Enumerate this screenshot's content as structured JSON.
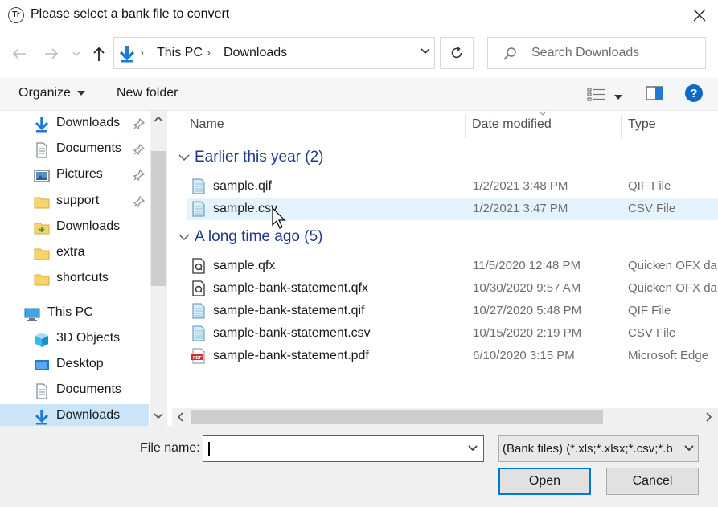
{
  "window": {
    "title": "Please select a bank file to convert",
    "app_icon_text": "Tr"
  },
  "nav": {
    "address_parts": [
      "This PC",
      "Downloads"
    ],
    "search_placeholder": "Search Downloads"
  },
  "toolbar": {
    "organize_label": "Organize",
    "new_folder_label": "New folder"
  },
  "sidebar": {
    "items": [
      {
        "label": "Downloads",
        "icon": "download-arrow-icon",
        "pinned": true
      },
      {
        "label": "Documents",
        "icon": "document-icon",
        "pinned": true
      },
      {
        "label": "Pictures",
        "icon": "pictures-icon",
        "pinned": true
      },
      {
        "label": "support",
        "icon": "folder-icon",
        "pinned": true
      },
      {
        "label": "Downloads",
        "icon": "folder-download-icon",
        "pinned": false
      },
      {
        "label": "extra",
        "icon": "folder-icon",
        "pinned": false
      },
      {
        "label": "shortcuts",
        "icon": "folder-icon",
        "pinned": false
      },
      {
        "label": "This PC",
        "icon": "computer-icon",
        "pinned": false
      },
      {
        "label": "3D Objects",
        "icon": "3d-objects-icon",
        "pinned": false
      },
      {
        "label": "Desktop",
        "icon": "desktop-icon",
        "pinned": false
      },
      {
        "label": "Documents",
        "icon": "document-icon",
        "pinned": false
      },
      {
        "label": "Downloads",
        "icon": "download-arrow-icon",
        "pinned": false,
        "selected": true
      }
    ]
  },
  "columns": {
    "name": "Name",
    "date": "Date modified",
    "type": "Type"
  },
  "groups": [
    {
      "label": "Earlier this year (2)",
      "files": [
        {
          "name": "sample.qif",
          "date": "1/2/2021 3:48 PM",
          "type": "QIF File",
          "icon": "text-file-icon"
        },
        {
          "name": "sample.csv",
          "date": "1/2/2021 3:47 PM",
          "type": "CSV File",
          "icon": "text-file-icon",
          "hover": true
        }
      ]
    },
    {
      "label": "A long time ago (5)",
      "files": [
        {
          "name": "sample.qfx",
          "date": "11/5/2020 12:48 PM",
          "type": "Quicken OFX da",
          "icon": "qfx-file-icon"
        },
        {
          "name": "sample-bank-statement.qfx",
          "date": "10/30/2020 9:57 AM",
          "type": "Quicken OFX da",
          "icon": "qfx-file-icon"
        },
        {
          "name": "sample-bank-statement.qif",
          "date": "10/27/2020 5:48 PM",
          "type": "QIF File",
          "icon": "text-file-icon"
        },
        {
          "name": "sample-bank-statement.csv",
          "date": "10/15/2020 2:19 PM",
          "type": "CSV File",
          "icon": "text-file-icon"
        },
        {
          "name": "sample-bank-statement.pdf",
          "date": "6/10/2020 3:15 PM",
          "type": "Microsoft Edge",
          "icon": "pdf-file-icon"
        }
      ]
    }
  ],
  "bottom": {
    "file_name_label": "File name:",
    "file_name_value": "",
    "filter_value": "(Bank files) (*.xls;*.xlsx;*.csv;*.b",
    "open_label": "Open",
    "cancel_label": "Cancel"
  },
  "colors": {
    "accent": "#0078d7",
    "group_header": "#1e3a8a",
    "selection": "#cce4f7",
    "hover": "#e5f3ff"
  }
}
